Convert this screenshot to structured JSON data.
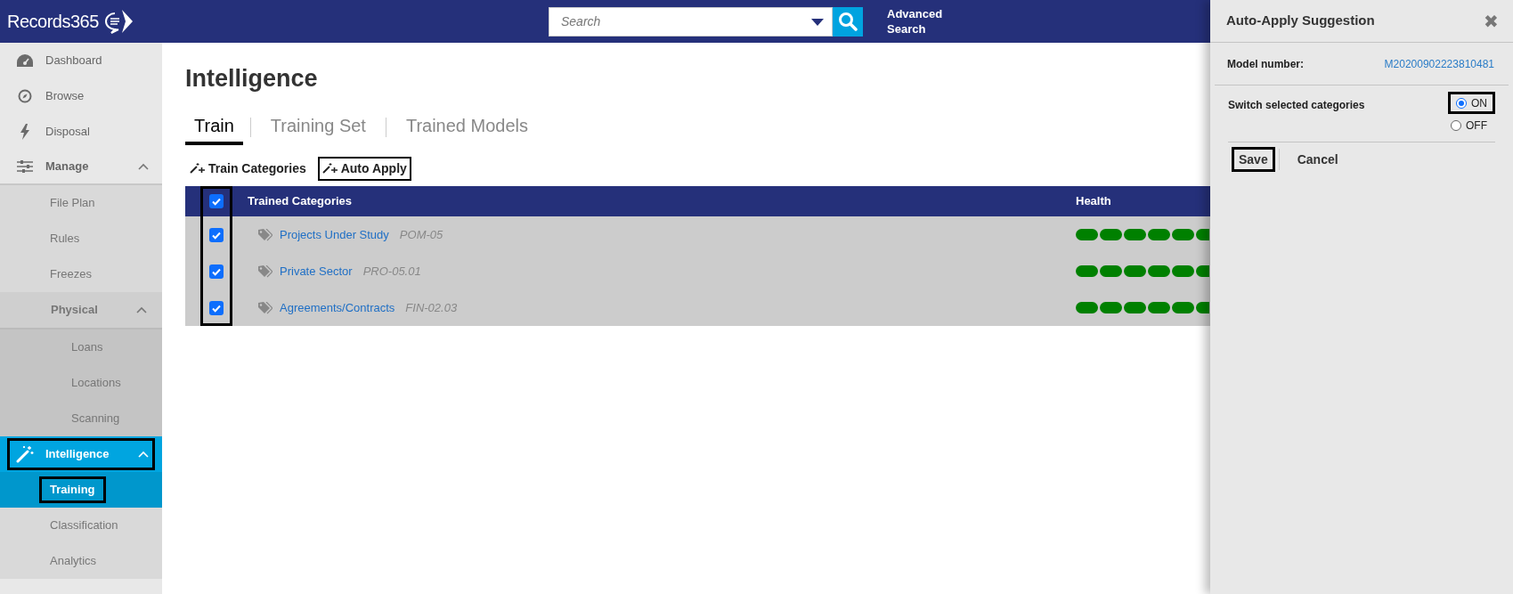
{
  "header": {
    "logo": "Records365",
    "search": {
      "placeholder": "Search"
    },
    "advanced_search": "Advanced Search"
  },
  "sidebar": {
    "items": [
      {
        "label": "Dashboard",
        "selected": false,
        "highlighted": false
      },
      {
        "label": "Browse",
        "selected": false,
        "highlighted": false
      },
      {
        "label": "Disposal",
        "selected": false,
        "highlighted": false
      },
      {
        "label": "Manage",
        "expanded": true,
        "selected": false,
        "highlighted": false,
        "children": [
          {
            "label": "File Plan",
            "selected": false,
            "highlighted": false
          },
          {
            "label": "Rules",
            "selected": false,
            "highlighted": false
          },
          {
            "label": "Freezes",
            "selected": false,
            "highlighted": false
          },
          {
            "label": "Physical",
            "expanded": true,
            "children": [
              {
                "label": "Loans",
                "selected": false,
                "highlighted": false
              },
              {
                "label": "Locations",
                "selected": false,
                "highlighted": false
              },
              {
                "label": "Scanning",
                "selected": false,
                "highlighted": false
              }
            ]
          }
        ]
      },
      {
        "label": "Intelligence",
        "expanded": true,
        "selected": true,
        "highlighted": true,
        "children": [
          {
            "label": "Training",
            "selected": true,
            "highlighted": true
          },
          {
            "label": "Classification",
            "selected": false,
            "highlighted": false
          },
          {
            "label": "Analytics",
            "selected": false,
            "highlighted": false
          }
        ]
      }
    ]
  },
  "page": {
    "title": "Intelligence",
    "tabs": [
      {
        "label": "Train",
        "selected": true
      },
      {
        "label": "Training Set",
        "selected": false
      },
      {
        "label": "Trained Models",
        "selected": false
      }
    ],
    "actions": [
      {
        "label": "Train Categories",
        "highlighted": false
      },
      {
        "label": "Auto Apply",
        "highlighted": true
      }
    ],
    "table": {
      "checkbox_column_highlighted": true,
      "select_all_checked": true,
      "columns": [
        "Trained Categories",
        "Health"
      ],
      "rows": [
        {
          "checked": true,
          "name": "Projects Under Study",
          "code": "POM-05"
        },
        {
          "checked": true,
          "name": "Private Sector",
          "code": "PRO-05.01"
        },
        {
          "checked": true,
          "name": "Agreements/Contracts",
          "code": "FIN-02.03"
        }
      ]
    }
  },
  "panel": {
    "title": "Auto-Apply Suggestion",
    "close": "✖",
    "model_label": "Model number:",
    "model_value": "M20200902223810481",
    "switch_label": "Switch selected categories",
    "options": [
      {
        "label": "ON",
        "selected": true,
        "highlighted": true
      },
      {
        "label": "OFF",
        "selected": false,
        "highlighted": false
      }
    ],
    "buttons": [
      {
        "label": "Save",
        "highlighted": true
      },
      {
        "label": "Cancel",
        "highlighted": false
      }
    ]
  }
}
